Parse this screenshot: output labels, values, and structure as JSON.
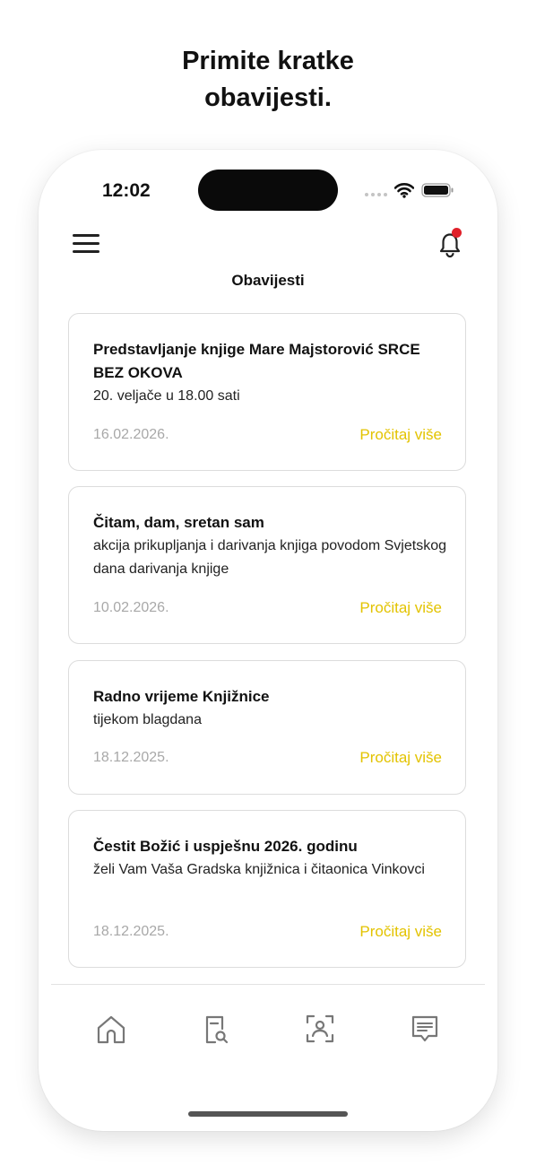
{
  "headline": {
    "line1": "Primite kratke",
    "line2": "obavijesti."
  },
  "status_bar": {
    "time": "12:02"
  },
  "header": {
    "title": "Obavijesti"
  },
  "notifications": [
    {
      "title": "Predstavljanje knjige Mare Majstorović SRCE BEZ OKOVA",
      "description": "20. veljače u 18.00 sati",
      "date": "16.02.2026.",
      "link": "Pročitaj više"
    },
    {
      "title": "Čitam, dam, sretan sam",
      "description": "akcija prikupljanja i darivanja knjiga povodom Svjetskog dana darivanja knjige",
      "date": "10.02.2026.",
      "link": "Pročitaj više"
    },
    {
      "title": "Radno vrijeme Knjižnice",
      "description": "tijekom blagdana",
      "date": "18.12.2025.",
      "link": "Pročitaj više"
    },
    {
      "title": "Čestit Božić i uspješnu 2026. godinu",
      "description": "želi Vam Vaša Gradska knjižnica i čitaonica Vinkovci",
      "date": "18.12.2025.",
      "link": "Pročitaj više"
    }
  ],
  "tab_bar": {
    "icons": [
      "home-icon",
      "document-search-icon",
      "scan-icon",
      "message-icon"
    ]
  },
  "colors": {
    "accent": "#e3c300",
    "badge": "#e0202a",
    "muted": "#a8a8a8"
  }
}
